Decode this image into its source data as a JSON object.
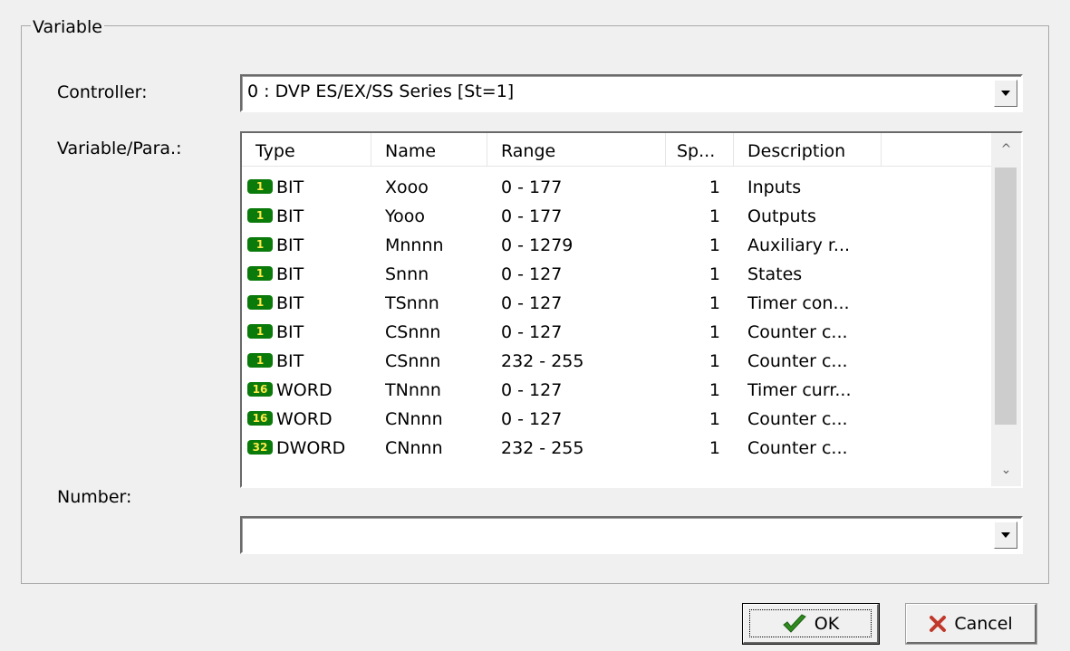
{
  "group_title": "Variable",
  "controller": {
    "label": "Controller:",
    "value": "0 : DVP ES/EX/SS Series [St=1]"
  },
  "variable": {
    "label": "Variable/Para.:",
    "columns": [
      "Type",
      "Name",
      "Range",
      "Sp...",
      "Description"
    ],
    "rows": [
      {
        "badge": "1",
        "type": "BIT",
        "name": "Xooo",
        "range": "0 - 177",
        "sp": "1",
        "desc": "Inputs"
      },
      {
        "badge": "1",
        "type": "BIT",
        "name": "Yooo",
        "range": "0 - 177",
        "sp": "1",
        "desc": "Outputs"
      },
      {
        "badge": "1",
        "type": "BIT",
        "name": "Mnnnn",
        "range": "0 - 1279",
        "sp": "1",
        "desc": "Auxiliary r..."
      },
      {
        "badge": "1",
        "type": "BIT",
        "name": "Snnn",
        "range": "0 - 127",
        "sp": "1",
        "desc": "States"
      },
      {
        "badge": "1",
        "type": "BIT",
        "name": "TSnnn",
        "range": "0 - 127",
        "sp": "1",
        "desc": "Timer con..."
      },
      {
        "badge": "1",
        "type": "BIT",
        "name": "CSnnn",
        "range": "0 - 127",
        "sp": "1",
        "desc": "Counter c..."
      },
      {
        "badge": "1",
        "type": "BIT",
        "name": "CSnnn",
        "range": "232 - 255",
        "sp": "1",
        "desc": "Counter c..."
      },
      {
        "badge": "16",
        "type": "WORD",
        "name": "TNnnn",
        "range": "0 - 127",
        "sp": "1",
        "desc": "Timer curr..."
      },
      {
        "badge": "16",
        "type": "WORD",
        "name": "CNnnn",
        "range": "0 - 127",
        "sp": "1",
        "desc": "Counter c..."
      },
      {
        "badge": "32",
        "type": "DWORD",
        "name": "CNnnn",
        "range": "232 - 255",
        "sp": "1",
        "desc": "Counter c..."
      }
    ]
  },
  "number": {
    "label": "Number:",
    "value": ""
  },
  "buttons": {
    "ok": "OK",
    "cancel": "Cancel"
  },
  "icons": {
    "ok": "checkmark-icon",
    "cancel": "x-icon",
    "accent_ok": "#2e8b1e",
    "accent_cancel": "#c0392b",
    "badge_bg": "#0a7a0a",
    "badge_fg": "#ffe94a"
  }
}
